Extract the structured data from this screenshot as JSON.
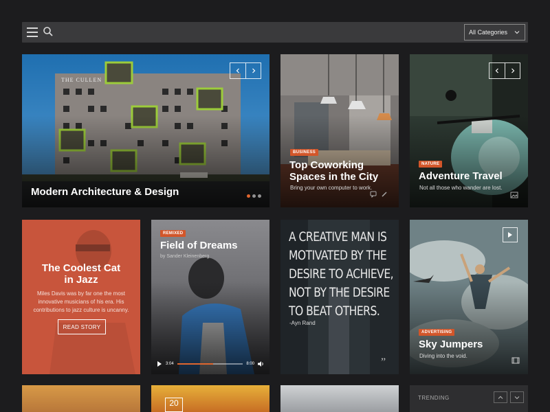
{
  "topbar": {
    "menu_icon": "hamburger-icon",
    "search_icon": "search-icon",
    "category_select": "All Categories"
  },
  "cards": {
    "architecture": {
      "title": "Modern Architecture & Design",
      "sign": "THE CULLEN"
    },
    "coworking": {
      "tag": "Business",
      "title_line1": "Top Coworking",
      "title_line2": "Spaces in the City",
      "subtitle": "Bring your own computer to work."
    },
    "adventure": {
      "tag": "Nature",
      "title": "Adventure Travel",
      "subtitle": "Not all those who wander are lost."
    },
    "jazz": {
      "title_line1": "The Coolest Cat",
      "title_line2": "in Jazz",
      "body": "Miles Davis was by far one the most innovative musicians of his era. His contributions to jazz culture is uncanny.",
      "button": "READ STORY"
    },
    "dreams": {
      "tag": "Remixed",
      "title": "Field of Dreams",
      "byline": "by Sander Kleinenberg",
      "time_current": "3:04",
      "time_total": "8:00"
    },
    "quote": {
      "lines": [
        "A CREATIVE MAN IS",
        "MOTIVATED BY THE",
        "DESIRE TO ACHIEVE,",
        "NOT BY THE DESIRE",
        "TO BEAT OTHERS."
      ],
      "author": "-Ayn Rand"
    },
    "sky": {
      "tag": "Advertising",
      "title": "Sky Jumpers",
      "subtitle": "Diving into the void."
    }
  },
  "bottom": {
    "date_day": "20",
    "trending": "TRENDING"
  },
  "colors": {
    "accent": "#e0662e",
    "background": "#1c1c1e",
    "topbar": "#3a3a3c"
  }
}
